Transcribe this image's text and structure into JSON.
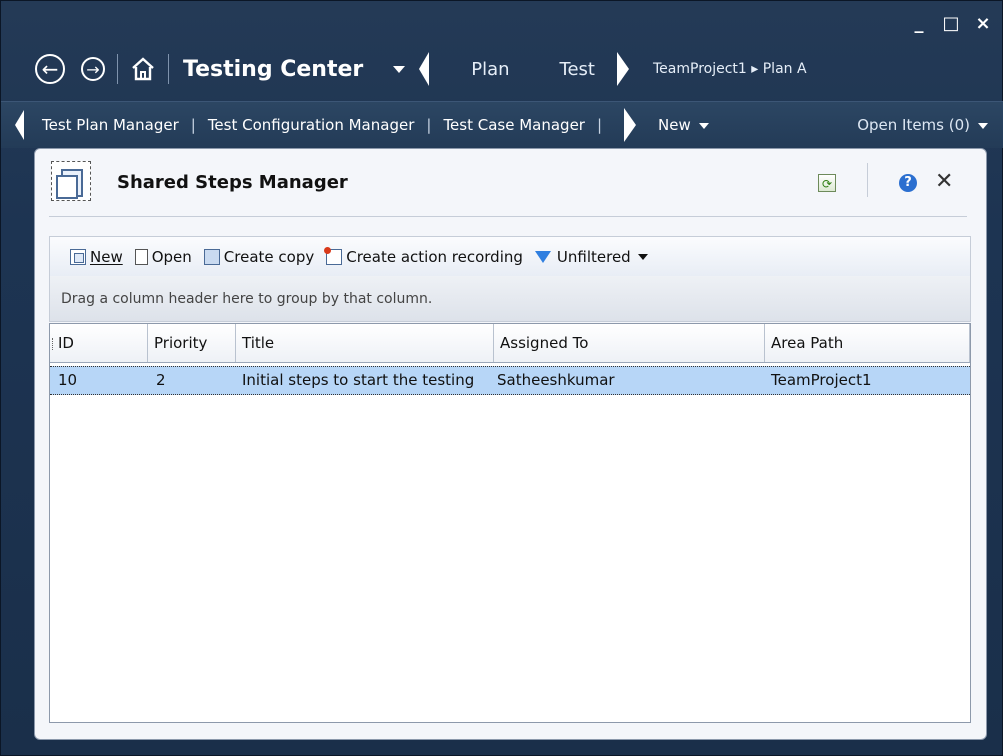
{
  "window": {
    "controls": {
      "minimize": "_",
      "maximize": "□",
      "close": "×"
    }
  },
  "topnav": {
    "back_icon": "arrow-left-circle",
    "forward_icon": "arrow-right-circle",
    "home_icon": "home",
    "app_title": "Testing Center",
    "tabs": [
      "Plan",
      "Test"
    ],
    "project_breadcrumb": "TeamProject1 ▸ Plan A"
  },
  "subnav": {
    "items": [
      "Test Plan Manager",
      "Test Configuration Manager",
      "Test Case Manager"
    ],
    "separator": "|",
    "new_label": "New",
    "open_items_label": "Open Items (0)"
  },
  "panel": {
    "title": "Shared Steps Manager",
    "refresh_icon": "refresh",
    "help_icon": "help",
    "close_label": "✕"
  },
  "toolbar": {
    "new_label": "New",
    "open_label": "Open",
    "create_copy_label": "Create copy",
    "create_action_recording_label": "Create action recording",
    "filter_label": "Unfiltered"
  },
  "groupbar": {
    "hint": "Drag a column header here to group by that column."
  },
  "grid": {
    "columns": [
      "ID",
      "Priority",
      "Title",
      "Assigned To",
      "Area Path"
    ],
    "rows": [
      [
        "10",
        "2",
        "Initial steps to start the testing",
        "Satheeshkumar",
        "TeamProject1"
      ]
    ],
    "selected_row_color": "#b7d6f7"
  },
  "colors": {
    "chrome_background": "#1d3452",
    "panel_background": "#f4f6fa",
    "accent": "#2f7fe0"
  }
}
